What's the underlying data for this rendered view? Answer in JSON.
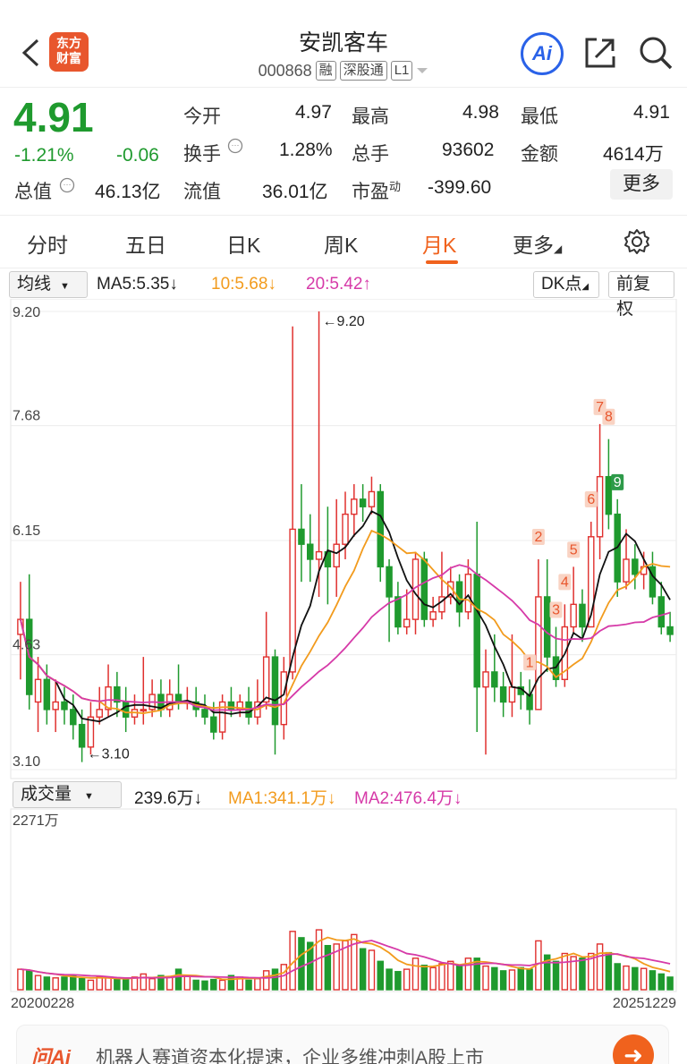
{
  "header": {
    "title": "安凯客车",
    "code": "000868",
    "tags": [
      "融",
      "深股通",
      "L1"
    ],
    "logo_text": [
      "东方",
      "财富"
    ],
    "ai_label": "Ai"
  },
  "quote": {
    "price": "4.91",
    "change_pct": "-1.21%",
    "change": "-0.06",
    "jinkai_label": "今开",
    "jinkai": "4.97",
    "zuigao_label": "最高",
    "zuigao": "4.98",
    "zuidi_label": "最低",
    "zuidi": "4.91",
    "huanshou_label": "换手",
    "huanshou": "1.28%",
    "zongshou_label": "总手",
    "zongshou": "93602",
    "jine_label": "金额",
    "jine": "4614万",
    "zongzhi_label": "总值",
    "zongzhi": "46.13亿",
    "liuzhi_label": "流值",
    "liuzhi": "36.01亿",
    "shiying_label": "市盈",
    "shiying_sup": "动",
    "shiying": "-399.60",
    "more": "更多"
  },
  "tabs": [
    "分时",
    "五日",
    "日K",
    "周K",
    "月K",
    "更多"
  ],
  "active_tab": "月K",
  "ma_bar": {
    "selector": "均线",
    "ma5": "MA5:5.35↓",
    "ma10": "10:5.68↓",
    "ma20": "20:5.42↑",
    "dk": "DK点",
    "fq": "前复权"
  },
  "vol_bar": {
    "selector": "成交量",
    "vol": "239.6万↓",
    "ma1": "MA1:341.1万↓",
    "ma2": "MA2:476.4万↓"
  },
  "colors": {
    "up": "#e0302e",
    "down": "#1f9a2e",
    "accent": "#f0621d",
    "ma5": "#111111",
    "ma10": "#f29b1d",
    "ma20": "#d63aa8"
  },
  "chart_data": {
    "type": "candlestick",
    "price_ticks": [
      "9.20",
      "7.68",
      "6.15",
      "4.63",
      "3.10"
    ],
    "high_label": "←9.20",
    "low_label": "←3.10",
    "volume_max_label": "2271万",
    "start_date": "20200228",
    "end_date": "20251229",
    "dk_markers": [
      "1",
      "2",
      "3",
      "4",
      "5",
      "6",
      "7",
      "8",
      "9"
    ],
    "candles": [
      [
        4.9,
        5.1,
        5.6,
        4.3
      ],
      [
        5.1,
        4.1,
        5.7,
        3.9
      ],
      [
        4.0,
        4.3,
        4.6,
        3.6
      ],
      [
        4.3,
        3.9,
        4.5,
        3.7
      ],
      [
        3.9,
        4.0,
        4.3,
        3.6
      ],
      [
        4.0,
        3.9,
        4.2,
        3.7
      ],
      [
        3.9,
        3.7,
        4.1,
        3.5
      ],
      [
        3.7,
        3.4,
        3.9,
        3.2
      ],
      [
        3.4,
        3.8,
        4.0,
        3.3
      ],
      [
        3.8,
        3.9,
        4.2,
        3.7
      ],
      [
        3.9,
        4.2,
        4.5,
        3.8
      ],
      [
        4.2,
        4.0,
        4.4,
        3.8
      ],
      [
        4.0,
        3.8,
        4.2,
        3.6
      ],
      [
        3.8,
        3.9,
        4.1,
        3.7
      ],
      [
        3.9,
        3.9,
        4.6,
        3.7
      ],
      [
        3.9,
        4.1,
        4.3,
        3.8
      ],
      [
        4.1,
        3.9,
        4.3,
        3.8
      ],
      [
        3.9,
        4.1,
        4.3,
        3.8
      ],
      [
        4.1,
        4.0,
        4.5,
        3.9
      ],
      [
        4.0,
        4.0,
        4.2,
        3.9
      ],
      [
        4.0,
        3.9,
        4.2,
        3.8
      ],
      [
        3.9,
        3.8,
        4.1,
        3.7
      ],
      [
        3.8,
        3.6,
        4.0,
        3.5
      ],
      [
        3.6,
        4.0,
        4.1,
        3.5
      ],
      [
        4.0,
        3.9,
        4.2,
        3.8
      ],
      [
        3.9,
        4.0,
        4.1,
        3.8
      ],
      [
        4.0,
        3.8,
        4.2,
        3.7
      ],
      [
        3.8,
        4.0,
        4.3,
        3.7
      ],
      [
        4.0,
        4.6,
        5.2,
        3.9
      ],
      [
        4.6,
        3.7,
        4.7,
        3.3
      ],
      [
        3.7,
        4.4,
        4.6,
        3.5
      ],
      [
        4.4,
        6.3,
        9.0,
        4.3
      ],
      [
        6.3,
        6.1,
        6.9,
        5.6
      ],
      [
        6.1,
        5.9,
        6.5,
        5.6
      ],
      [
        5.9,
        6.0,
        9.2,
        5.4
      ],
      [
        6.0,
        5.8,
        6.6,
        5.3
      ],
      [
        5.8,
        6.1,
        6.7,
        5.4
      ],
      [
        6.1,
        6.5,
        6.8,
        5.9
      ],
      [
        6.5,
        6.7,
        6.9,
        6.2
      ],
      [
        6.7,
        6.6,
        6.9,
        6.4
      ],
      [
        6.6,
        6.8,
        7.0,
        6.5
      ],
      [
        6.8,
        5.8,
        6.9,
        5.6
      ],
      [
        5.8,
        5.4,
        5.9,
        4.8
      ],
      [
        5.4,
        5.0,
        5.6,
        4.9
      ],
      [
        5.0,
        5.1,
        5.5,
        4.9
      ],
      [
        5.1,
        5.9,
        6.0,
        4.9
      ],
      [
        5.9,
        5.1,
        6.0,
        5.0
      ],
      [
        5.1,
        5.2,
        5.4,
        5.0
      ],
      [
        5.2,
        5.4,
        6.0,
        5.1
      ],
      [
        5.4,
        5.6,
        5.8,
        5.3
      ],
      [
        5.6,
        5.2,
        5.7,
        5.0
      ],
      [
        5.2,
        5.7,
        5.9,
        5.1
      ],
      [
        5.7,
        4.2,
        6.4,
        3.6
      ],
      [
        4.2,
        4.4,
        4.7,
        3.3
      ],
      [
        4.4,
        4.2,
        4.9,
        4.0
      ],
      [
        4.2,
        4.0,
        4.4,
        3.8
      ],
      [
        4.0,
        4.2,
        4.9,
        3.8
      ],
      [
        4.2,
        4.1,
        4.4,
        3.9
      ],
      [
        4.1,
        3.9,
        4.3,
        3.7
      ],
      [
        3.9,
        5.4,
        5.9,
        3.9
      ],
      [
        5.4,
        4.6,
        5.9,
        4.4
      ],
      [
        4.6,
        4.3,
        5.0,
        4.2
      ],
      [
        4.3,
        5.0,
        5.3,
        4.2
      ],
      [
        5.0,
        5.3,
        5.8,
        4.9
      ],
      [
        5.3,
        5.0,
        5.5,
        4.8
      ],
      [
        5.0,
        6.2,
        6.4,
        5.0
      ],
      [
        6.2,
        7.0,
        7.7,
        5.9
      ],
      [
        7.0,
        6.5,
        7.5,
        6.3
      ],
      [
        6.5,
        5.6,
        6.7,
        5.4
      ],
      [
        5.6,
        5.9,
        6.3,
        5.5
      ],
      [
        5.9,
        5.7,
        6.1,
        5.5
      ],
      [
        5.7,
        5.8,
        6.0,
        5.5
      ],
      [
        5.8,
        5.4,
        6.0,
        5.3
      ],
      [
        5.4,
        5.0,
        5.6,
        4.9
      ],
      [
        5.0,
        4.9,
        5.2,
        4.8
      ]
    ],
    "volumes": [
      260,
      240,
      180,
      160,
      150,
      160,
      180,
      140,
      120,
      160,
      150,
      140,
      130,
      160,
      200,
      140,
      180,
      160,
      260,
      180,
      120,
      110,
      130,
      120,
      180,
      160,
      120,
      140,
      240,
      260,
      320,
      740,
      660,
      600,
      760,
      560,
      580,
      620,
      700,
      520,
      500,
      360,
      260,
      230,
      260,
      400,
      310,
      280,
      330,
      360,
      300,
      400,
      400,
      300,
      280,
      240,
      250,
      280,
      260,
      620,
      440,
      360,
      460,
      420,
      400,
      460,
      580,
      470,
      330,
      300,
      280,
      270,
      240,
      200,
      160
    ]
  },
  "banner": {
    "logo": "问Ai",
    "text": "机器人赛道资本化提速，企业多维冲刺A股上市"
  }
}
